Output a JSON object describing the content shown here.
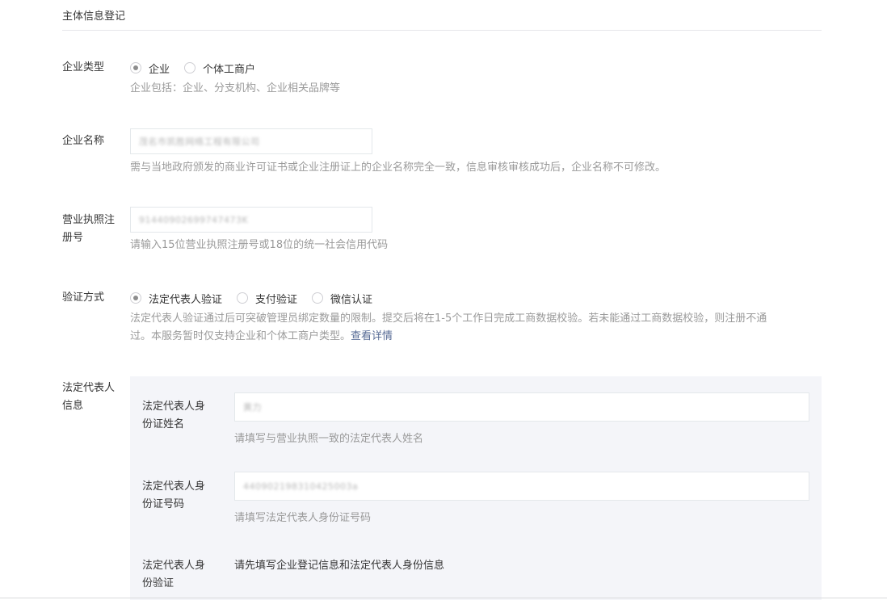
{
  "section": {
    "title": "主体信息登记"
  },
  "enterprise_type": {
    "label": "企业类型",
    "options": [
      {
        "label": "企业",
        "checked": true
      },
      {
        "label": "个体工商户",
        "checked": false
      }
    ],
    "tip": "企业包括：企业、分支机构、企业相关品牌等"
  },
  "enterprise_name": {
    "label": "企业名称",
    "value": "茂名市凯胜网络工程有限公司",
    "tip": "需与当地政府颁发的商业许可证书或企业注册证上的企业名称完全一致，信息审核审核成功后，企业名称不可修改。"
  },
  "license": {
    "label_line1": "营业执照注",
    "label_line2": "册号",
    "value": "91440902699747473K",
    "tip": "请输入15位营业执照注册号或18位的统一社会信用代码"
  },
  "verify": {
    "label": "验证方式",
    "options": [
      {
        "label": "法定代表人验证",
        "checked": true
      },
      {
        "label": "支付验证",
        "checked": false
      },
      {
        "label": "微信认证",
        "checked": false
      }
    ],
    "tip_line1": "法定代表人验证通过后可突破管理员绑定数量的限制。提交后将在1-5个工作日完成工商数据校验。若未能通过工商数据校验，则注册不通",
    "tip_line2": "过。本服务暂时仅支持企业和个体工商户类型。",
    "tip_link": "查看详情"
  },
  "legal": {
    "label_line1": "法定代表人",
    "label_line2": "信息",
    "name": {
      "label_line1": "法定代表人身",
      "label_line2": "份证姓名",
      "value": "黄力",
      "tip": "请填写与营业执照一致的法定代表人姓名"
    },
    "id_number": {
      "label_line1": "法定代表人身",
      "label_line2": "份证号码",
      "value": "440902198310425003a",
      "tip": "请填写法定代表人身份证号码"
    },
    "verification": {
      "label_line1": "法定代表人身",
      "label_line2": "份验证",
      "text": "请先填写企业登记信息和法定代表人身份信息"
    }
  }
}
